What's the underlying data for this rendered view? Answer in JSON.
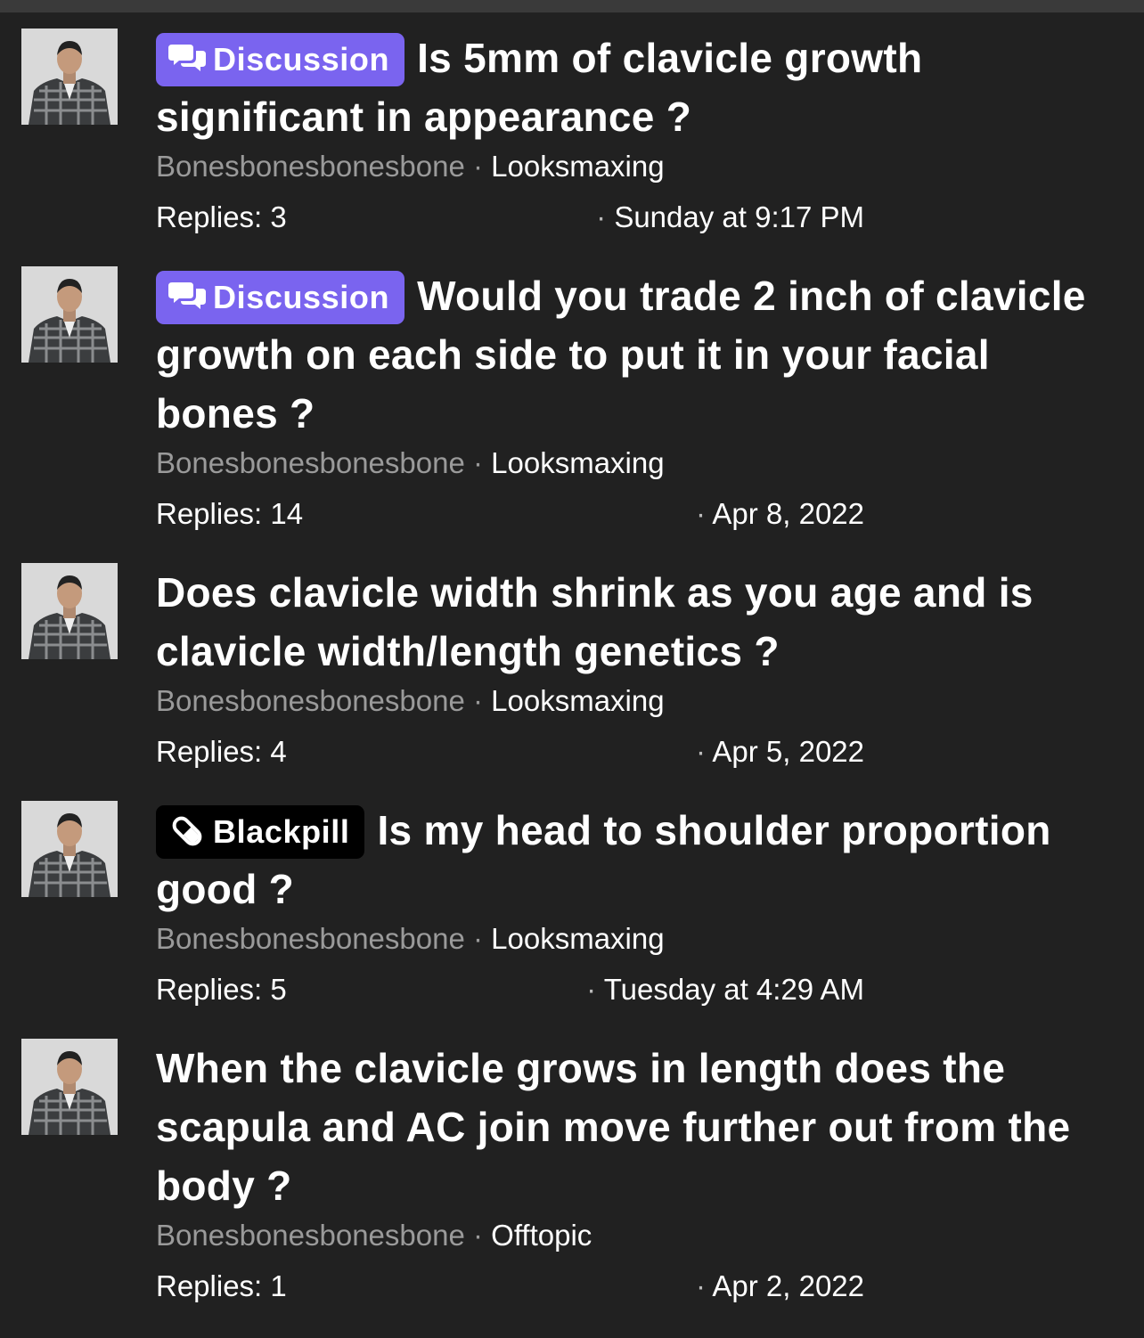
{
  "threads": [
    {
      "label": "Discussion",
      "label_type": "discussion",
      "title": "Is 5mm of clavicle growth significant in appearance ?",
      "author": "Bonesbonesbonesbone",
      "forum": "Looksmaxing",
      "replies": "Replies: 3",
      "date": "Sunday at 9:17 PM"
    },
    {
      "label": "Discussion",
      "label_type": "discussion",
      "title": "Would you trade 2 inch of clavicle growth on each side to put it in your facial bones ?",
      "author": "Bonesbonesbonesbone",
      "forum": "Looksmaxing",
      "replies": "Replies: 14",
      "date": "Apr 8, 2022"
    },
    {
      "label": "",
      "label_type": "none",
      "title": "Does clavicle width shrink as you age and is clavicle width/length genetics ?",
      "author": "Bonesbonesbonesbone",
      "forum": "Looksmaxing",
      "replies": "Replies: 4",
      "date": "Apr 5, 2022"
    },
    {
      "label": "Blackpill",
      "label_type": "blackpill",
      "title": "Is my head to shoulder proportion good ?",
      "author": "Bonesbonesbonesbone",
      "forum": "Looksmaxing",
      "replies": "Replies: 5",
      "date": "Tuesday at 4:29 AM"
    },
    {
      "label": "",
      "label_type": "none",
      "title": "When the clavicle grows in length does the scapula and AC join move further out from the body ?",
      "author": "Bonesbonesbonesbone",
      "forum": "Offtopic",
      "replies": "Replies: 1",
      "date": "Apr 2, 2022"
    }
  ],
  "separator": "·",
  "icons": {
    "discussion": "chat-bubbles-icon",
    "blackpill": "pill-icon",
    "avatar": "user-avatar"
  },
  "colors": {
    "background": "#212121",
    "discussion_label": "#7a64ef",
    "blackpill_label": "#000000",
    "author": "#9a9a9a"
  }
}
